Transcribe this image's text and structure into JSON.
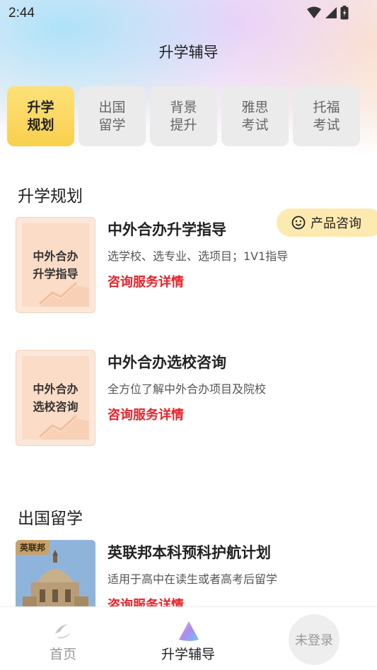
{
  "status": {
    "time": "2:44"
  },
  "header": {
    "title": "升学辅导"
  },
  "tabs": [
    {
      "line1": "升学",
      "line2": "规划",
      "active": true
    },
    {
      "line1": "出国",
      "line2": "留学",
      "active": false
    },
    {
      "line1": "背景",
      "line2": "提升",
      "active": false
    },
    {
      "line1": "雅思",
      "line2": "考试",
      "active": false
    },
    {
      "line1": "托福",
      "line2": "考试",
      "active": false
    }
  ],
  "consult_button": {
    "label": "产品咨询"
  },
  "sections": [
    {
      "title": "升学规划",
      "items": [
        {
          "thumb_line1": "中外合办",
          "thumb_line2": "升学指导",
          "title": "中外合办升学指导",
          "desc": "选学校、选专业、选项目；1V1指导",
          "link": "咨询服务详情"
        },
        {
          "thumb_line1": "中外合办",
          "thumb_line2": "选校咨询",
          "title": "中外合办选校咨询",
          "desc": "全方位了解中外合办项目及院校",
          "link": "咨询服务详情"
        }
      ]
    },
    {
      "title": "出国留学",
      "items": [
        {
          "badge": "英联邦",
          "title": "英联邦本科预科护航计划",
          "desc": "适用于高中在读生或者高考后留学",
          "link": "咨询服务详情"
        }
      ]
    }
  ],
  "bottom_nav": {
    "home": "首页",
    "guide": "升学辅导",
    "login": "未登录"
  },
  "colors": {
    "accent_yellow": "#f8d04d",
    "link_red": "#e8232a",
    "pill_bg": "#fdeab0"
  }
}
